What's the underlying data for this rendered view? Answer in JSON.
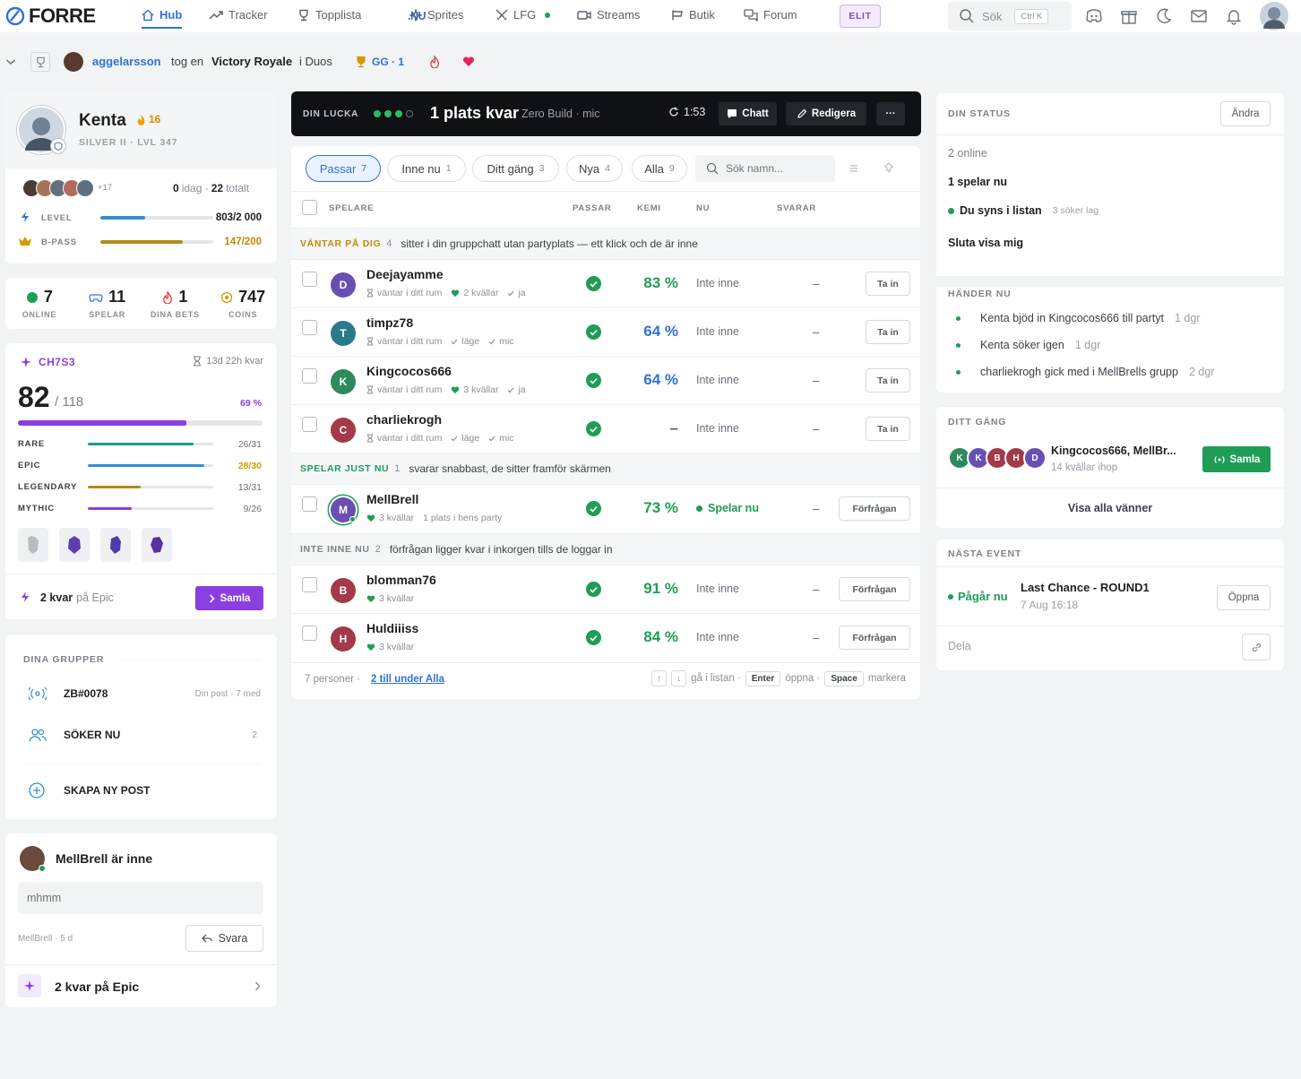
{
  "brand": {
    "name_a": "FORRE",
    "name_b": ".NU"
  },
  "nav": {
    "items": [
      {
        "label": "Hub",
        "active": true
      },
      {
        "label": "Tracker"
      },
      {
        "label": "Topplista"
      },
      {
        "label": "Sprites"
      },
      {
        "label": "LFG"
      },
      {
        "label": "Streams"
      },
      {
        "label": "Butik"
      },
      {
        "label": "Forum"
      }
    ],
    "elit": "ELIT",
    "search_label": "Sök",
    "search_kbd": "Ctrl K"
  },
  "activity": {
    "user": "aggelarsson",
    "text_a": "tog en",
    "highlight": "Victory Royale",
    "text_b": "i Duos",
    "gg": "GG · 1"
  },
  "profile": {
    "name": "Kenta",
    "streak": "16",
    "rank": "SILVER II · LVL 347",
    "friends_more": "+17",
    "today_a": "0",
    "today_b": "idag ·",
    "today_c": "22",
    "today_d": "totalt",
    "level_label": "LEVEL",
    "level_value": "803/2 000",
    "level_pct": 40,
    "bpass_label": "B-PASS",
    "bpass_value": "147/200",
    "bpass_pct": 73
  },
  "stats": [
    {
      "value": "7",
      "label": "ONLINE",
      "color": "#1f9d57"
    },
    {
      "value": "11",
      "label": "SPELAR",
      "color": "#2f72d6"
    },
    {
      "value": "1",
      "label": "DINA BETS",
      "color": "#e53935"
    },
    {
      "value": "747",
      "label": "COINS",
      "color": "#d49a00"
    }
  ],
  "season": {
    "code": "CH7S3",
    "time_left": "13d 22h kvar",
    "count": "82",
    "total": "/ 118",
    "pct_label": "69 %",
    "pct": 69,
    "rarities": [
      {
        "name": "RARE",
        "value": "26/31",
        "pct": 84,
        "color": "#1a9c8a"
      },
      {
        "name": "EPIC",
        "value": "28/30",
        "pct": 93,
        "color": "#2f8fd6"
      },
      {
        "name": "LEGENDARY",
        "value": "13/31",
        "pct": 42,
        "color": "#b48a1a"
      },
      {
        "name": "MYTHIC",
        "value": "9/26",
        "pct": 35,
        "color": "#8b3fe0"
      }
    ],
    "left_a": "2 kvar",
    "left_b": "på Epic",
    "collect_btn": "Samla"
  },
  "groups": {
    "title": "DINA GRUPPER",
    "items": [
      {
        "name": "ZB#0078",
        "meta": "Din post · 7 med"
      },
      {
        "name": "SÖKER NU",
        "meta": "2"
      },
      {
        "name": "SKAPA NY POST",
        "meta": ""
      }
    ]
  },
  "message": {
    "title": "MellBrell är inne",
    "body": "mhmm",
    "meta": "MellBrell · 5 d",
    "reply": "Svara"
  },
  "epic_link": "2 kvar på Epic",
  "lucka": {
    "label": "DIN LUCKA",
    "title": "1 plats kvar",
    "sub": "Zero Build · mic",
    "timer": "1:53",
    "chat": "Chatt",
    "edit": "Redigera",
    "more": "···"
  },
  "filters": [
    {
      "label": "Passar",
      "count": "7",
      "on": true
    },
    {
      "label": "Inne nu",
      "count": "1"
    },
    {
      "label": "Ditt gäng",
      "count": "3"
    },
    {
      "label": "Nya",
      "count": "4"
    },
    {
      "label": "Alla",
      "count": "9"
    }
  ],
  "search_placeholder": "Sök namn...",
  "columns": {
    "spelare": "SPELARE",
    "passar": "PASSAR",
    "kemi": "KEMI",
    "nu": "NU",
    "svarar": "SVARAR"
  },
  "sections": {
    "s1_tag": "VÄNTAR PÅ DIG",
    "s1_count": "4",
    "s1_text": "sitter i din gruppchatt utan partyplats — ett klick och de är inne",
    "s2_tag": "SPELAR JUST NU",
    "s2_count": "1",
    "s2_text": "svarar snabbast, de sitter framför skärmen",
    "s3_tag": "INTE INNE NU",
    "s3_count": "2",
    "s3_text": "förfrågan ligger kvar i inkorgen tills de loggar in"
  },
  "players": [
    {
      "name": "Deejayamme",
      "initial": "D",
      "color": "#6a4fb3",
      "sub_a": "väntar i ditt rum",
      "sub_b": "2 kvällar",
      "sub_c": "ja",
      "kemi": "83 %",
      "kemi_color": "#1f9d57",
      "nu": "Inte inne",
      "svarar": "–",
      "action": "Ta in"
    },
    {
      "name": "timpz78",
      "initial": "T",
      "color": "#2b7a8a",
      "sub_a": "väntar i ditt rum",
      "sub_b": "läge",
      "sub_c": "mic",
      "kemi": "64 %",
      "kemi_color": "#2f72d6",
      "nu": "Inte inne",
      "svarar": "–",
      "action": "Ta in"
    },
    {
      "name": "Kingcocos666",
      "initial": "K",
      "color": "#2e8a5c",
      "sub_a": "väntar i ditt rum",
      "sub_b": "3 kvällar",
      "sub_c": "ja",
      "kemi": "64 %",
      "kemi_color": "#2f72d6",
      "nu": "Inte inne",
      "svarar": "–",
      "action": "Ta in"
    },
    {
      "name": "charliekrogh",
      "initial": "C",
      "color": "#a23a4a",
      "sub_a": "väntar i ditt rum",
      "sub_b": "läge",
      "sub_c": "mic",
      "kemi": "–",
      "kemi_color": "#555a62",
      "nu": "Inte inne",
      "svarar": "–",
      "action": "Ta in"
    },
    {
      "name": "MellBrell",
      "initial": "M",
      "color": "#6a4fb3",
      "sub_a": "3 kvällar",
      "sub_b": "1 plats i hens party",
      "sub_c": "",
      "kemi": "73 %",
      "kemi_color": "#1f9d57",
      "nu": "Spelar nu",
      "svarar": "–",
      "action": "Förfrågan"
    },
    {
      "name": "blomman76",
      "initial": "B",
      "color": "#a23a4a",
      "sub_a": "3 kvällar",
      "sub_b": "",
      "sub_c": "",
      "kemi": "91 %",
      "kemi_color": "#1f9d57",
      "nu": "Inte inne",
      "svarar": "–",
      "action": "Förfrågan"
    },
    {
      "name": "Huldiiiss",
      "initial": "H",
      "color": "#a23a4a",
      "sub_a": "3 kvällar",
      "sub_b": "",
      "sub_c": "",
      "kemi": "84 %",
      "kemi_color": "#1f9d57",
      "nu": "Inte inne",
      "svarar": "–",
      "action": "Förfrågan"
    }
  ],
  "footer": {
    "count": "7 personer ·",
    "link": "2 till under Alla",
    "hint_a": "gå i listan ·",
    "kbd_enter": "Enter",
    "hint_b": "öppna ·",
    "kbd_space": "Space",
    "hint_c": "markera"
  },
  "status": {
    "title": "DIN STATUS",
    "change": "Ändra",
    "online": "2 online",
    "playing": "1 spelar nu",
    "visible": "Du syns i listan",
    "visible_sub": "3 söker lag",
    "stop": "Sluta visa mig"
  },
  "happening": {
    "title": "HÄNDER NU",
    "items": [
      {
        "text": "Kenta bjöd in Kingcocos666 till partyt",
        "ago": "1 dgr"
      },
      {
        "text": "Kenta söker igen",
        "ago": "1 dgr"
      },
      {
        "text": "charliekrogh gick med i MellBrells grupp",
        "ago": "2 dgr"
      }
    ]
  },
  "gang": {
    "title": "DITT GÄNG",
    "names": "Kingcocos666, MellBr...",
    "sub": "14 kvällar ihop",
    "btn": "Samla",
    "all": "Visa alla vänner",
    "avatars": [
      {
        "i": "K",
        "c": "#2e8a5c"
      },
      {
        "i": "K",
        "c": "#6a4fb3"
      },
      {
        "i": "B",
        "c": "#a23a4a"
      },
      {
        "i": "H",
        "c": "#a23a4a"
      },
      {
        "i": "D",
        "c": "#6a4fb3"
      }
    ]
  },
  "event": {
    "title": "NÄSTA EVENT",
    "status": "Pågår nu",
    "name": "Last Chance - ROUND1",
    "date": "7 Aug 16:18",
    "open": "Öppna",
    "share": "Dela"
  }
}
